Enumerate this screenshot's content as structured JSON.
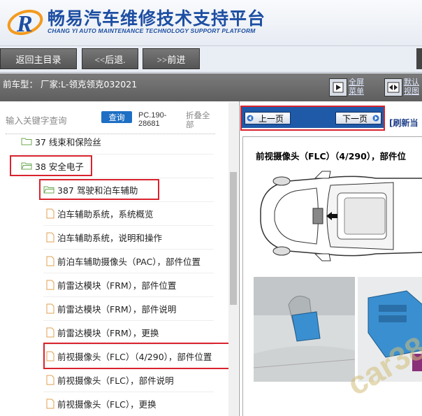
{
  "header": {
    "title_cn": "畅易汽车维修技术支持平台",
    "title_en": "CHANG YI AUTO MAINTENANCE TECHNOLOGY SUPPORT PLATFORM",
    "logo_letter": "R"
  },
  "toolbar": {
    "home_label": "返回主目录",
    "back_label": "<<后退.",
    "forward_label": ">>前进"
  },
  "carbar": {
    "current_model": "前车型：  厂家:L-领克领克032021",
    "fullscreen_label_1": "全屏",
    "fullscreen_label_2": "菜单",
    "default_label_1": "默认",
    "default_label_2": "视图"
  },
  "search": {
    "placeholder": "输入关键字查询",
    "button_label": "查询",
    "pc_code_1": "PC.190-",
    "pc_code_2": "28681",
    "fold_label_1": "折叠全",
    "fold_label_2": "部"
  },
  "tree": {
    "items": [
      {
        "label": "37 线束和保险丝",
        "type": "folder"
      },
      {
        "label": "38 安全电子",
        "type": "folder"
      },
      {
        "label": "387 驾驶和泊车辅助",
        "type": "folder"
      },
      {
        "label": "泊车辅助系统，系统概览",
        "type": "doc"
      },
      {
        "label": "泊车辅助系统，说明和操作",
        "type": "doc"
      },
      {
        "label": "前泊车辅助摄像头（PAC），部件位置",
        "type": "doc"
      },
      {
        "label": "前雷达模块（FRM），部件位置",
        "type": "doc"
      },
      {
        "label": "前雷达模块（FRM），部件说明",
        "type": "doc"
      },
      {
        "label": "前雷达模块（FRM），更换",
        "type": "doc"
      },
      {
        "label": "前视摄像头（FLC）（4/290），部件位置",
        "type": "doc"
      },
      {
        "label": "前视摄像头（FLC），部件说明",
        "type": "doc"
      },
      {
        "label": "前视摄像头（FLC），更换",
        "type": "doc"
      }
    ]
  },
  "viewer": {
    "prev_label": "上一页",
    "next_label": "下一页",
    "refresh_label": "[刷新当",
    "doc_title": "前视摄像头（FLC）（4/290），部件位",
    "watermark": "car38",
    "highlight_color": "#d9232d",
    "connector_color": "#3a8fd0"
  }
}
